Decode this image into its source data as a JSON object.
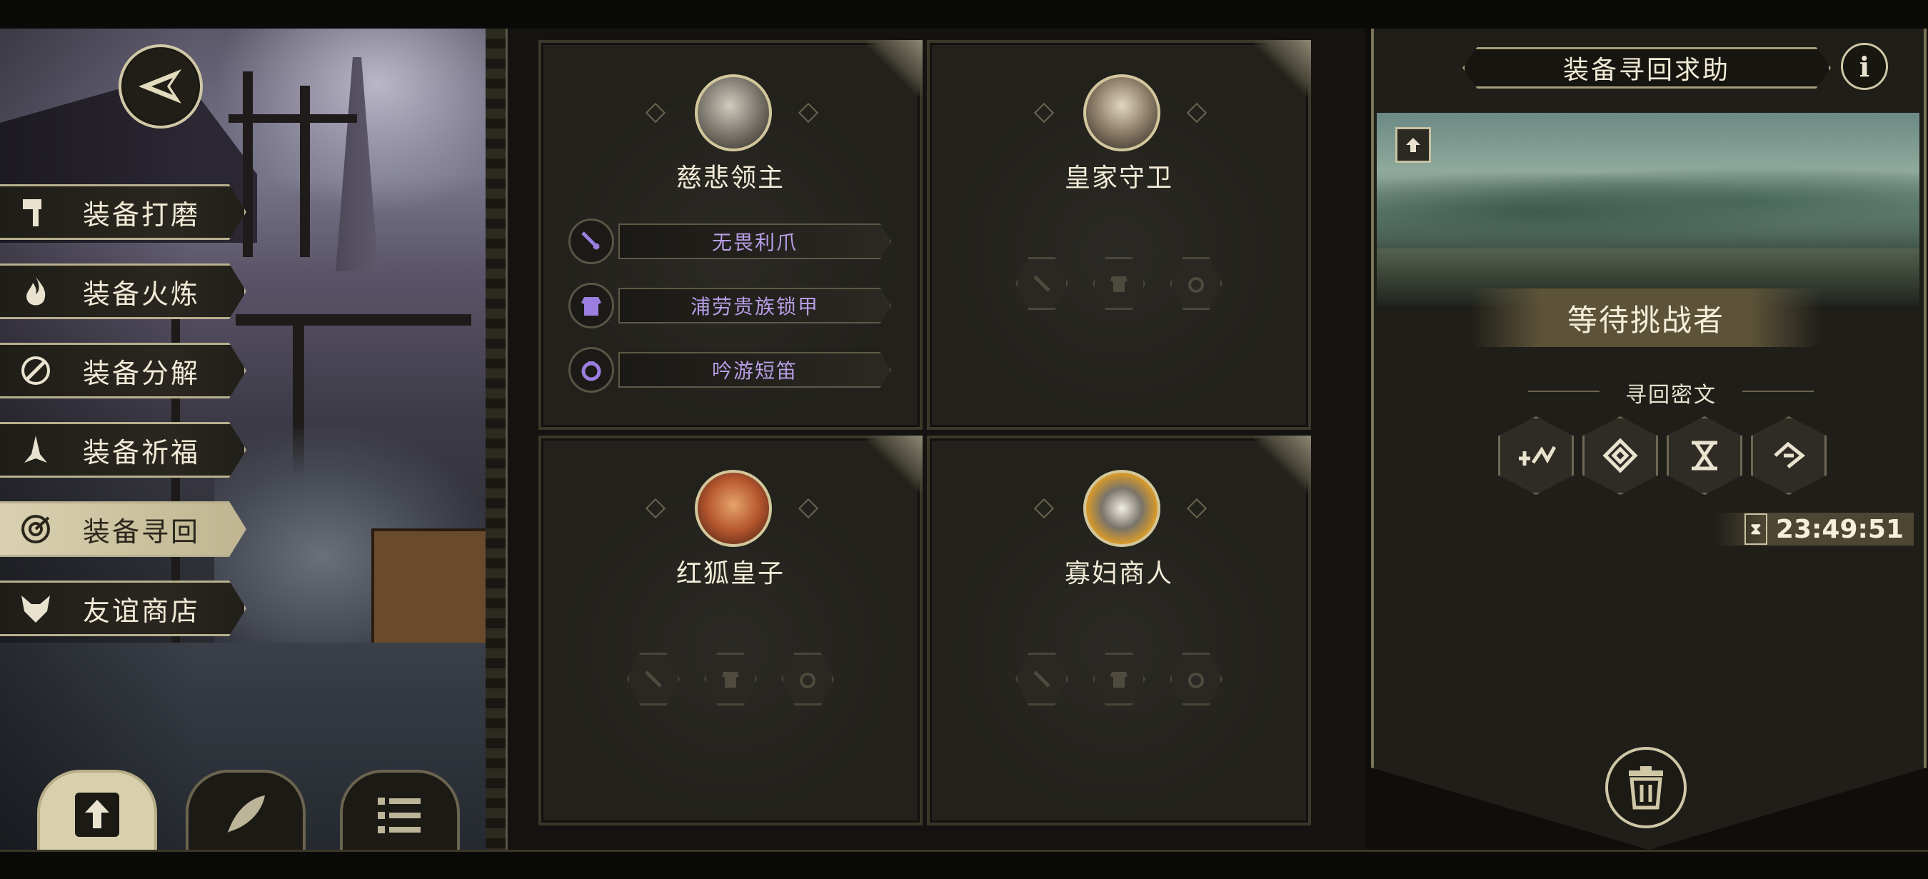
{
  "menu": [
    {
      "label": "装备打磨",
      "icon": "hammer-icon"
    },
    {
      "label": "装备火炼",
      "icon": "flame-icon"
    },
    {
      "label": "装备分解",
      "icon": "decompose-icon"
    },
    {
      "label": "装备祈福",
      "icon": "pray-icon"
    },
    {
      "label": "装备寻回",
      "icon": "retrieve-icon",
      "active": true
    },
    {
      "label": "友谊商店",
      "icon": "fox-icon"
    }
  ],
  "toolbar": [
    "upload-icon",
    "feather-icon",
    "list-icon"
  ],
  "cards": [
    {
      "name": "慈悲领主",
      "portrait": "armored-lord",
      "equipment": [
        {
          "label": "无畏利爪",
          "icon": "sword-icon"
        },
        {
          "label": "浦劳贵族锁甲",
          "icon": "armor-icon"
        },
        {
          "label": "吟游短笛",
          "icon": "ring-icon"
        }
      ]
    },
    {
      "name": "皇家守卫",
      "portrait": "royal-guard",
      "equipment": []
    },
    {
      "name": "红狐皇子",
      "portrait": "red-fox-prince",
      "equipment": []
    },
    {
      "name": "寡妇商人",
      "portrait": "widow-merchant",
      "equipment": []
    }
  ],
  "right_panel": {
    "title": "装备寻回求助",
    "info_label": "i",
    "status": "等待挑战者",
    "cipher_title": "寻回密文",
    "runes": [
      "rune-1-icon",
      "rune-2-icon",
      "rune-3-icon",
      "rune-4-icon"
    ],
    "timer": "23:49:51"
  },
  "colors": {
    "gold_border": "#cfc7a6",
    "equip_text": "#b79ee6",
    "panel_bg": "#1f1e19"
  }
}
